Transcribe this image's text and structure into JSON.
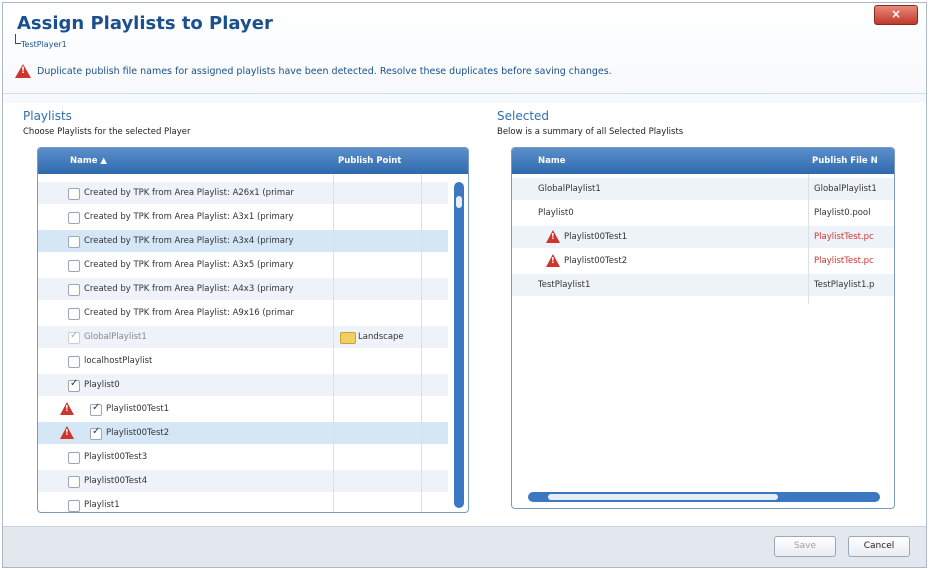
{
  "dialog": {
    "title": "Assign Playlists to Player",
    "subtitle": "TestPlayer1",
    "close_label": "×",
    "warning": "Duplicate publish file names for assigned playlists have been detected.  Resolve these duplicates before saving changes."
  },
  "left": {
    "title": "Playlists",
    "subtitle": "Choose Playlists for the selected Player",
    "col_name": "Name ▲",
    "col_publish": "Publish Point",
    "rows": [
      {
        "label": "Created by TPK from Area Playlist: A26x1 (primar",
        "publish": "",
        "checked": false,
        "warn": false,
        "style": "alt"
      },
      {
        "label": "Created by TPK from Area Playlist: A3x1 (primary",
        "publish": "",
        "checked": false,
        "warn": false,
        "style": ""
      },
      {
        "label": "Created by TPK from Area Playlist: A3x4 (primary",
        "publish": "",
        "checked": false,
        "warn": false,
        "style": "sel"
      },
      {
        "label": "Created by TPK from Area Playlist: A3x5 (primary",
        "publish": "",
        "checked": false,
        "warn": false,
        "style": ""
      },
      {
        "label": "Created by TPK from Area Playlist: A4x3 (primary",
        "publish": "",
        "checked": false,
        "warn": false,
        "style": "alt"
      },
      {
        "label": "Created by TPK from Area Playlist: A9x16 (primar",
        "publish": "",
        "checked": false,
        "warn": false,
        "style": ""
      },
      {
        "label": "GlobalPlaylist1",
        "publish": "Landscape",
        "checked": true,
        "dim": true,
        "warn": false,
        "style": "alt"
      },
      {
        "label": "localhostPlaylist",
        "publish": "",
        "checked": false,
        "warn": false,
        "style": ""
      },
      {
        "label": "Playlist0",
        "publish": "",
        "checked": true,
        "warn": false,
        "style": "alt"
      },
      {
        "label": "Playlist00Test1",
        "publish": "",
        "checked": true,
        "warn": true,
        "style": ""
      },
      {
        "label": "Playlist00Test2",
        "publish": "",
        "checked": true,
        "warn": true,
        "style": "sel"
      },
      {
        "label": "Playlist00Test3",
        "publish": "",
        "checked": false,
        "warn": false,
        "style": ""
      },
      {
        "label": "Playlist00Test4",
        "publish": "",
        "checked": false,
        "warn": false,
        "style": "alt"
      },
      {
        "label": "Playlist1",
        "publish": "",
        "checked": false,
        "warn": false,
        "style": ""
      }
    ]
  },
  "right": {
    "title": "Selected",
    "subtitle": "Below is a summary of all Selected Playlists",
    "col_name": "Name",
    "col_file": "Publish File N",
    "rows": [
      {
        "name": "GlobalPlaylist1",
        "file": "GlobalPlaylist1",
        "warn": false,
        "style": "alt"
      },
      {
        "name": "Playlist0",
        "file": "Playlist0.pool",
        "warn": false,
        "style": ""
      },
      {
        "name": "Playlist00Test1",
        "file": "PlaylistTest.pc",
        "warn": true,
        "style": "alt"
      },
      {
        "name": "Playlist00Test2",
        "file": "PlaylistTest.pc",
        "warn": true,
        "style": ""
      },
      {
        "name": "TestPlaylist1",
        "file": "TestPlaylist1.p",
        "warn": false,
        "style": "alt"
      }
    ]
  },
  "footer": {
    "save_label": "Save",
    "cancel_label": "Cancel"
  },
  "colors": {
    "accent": "#2f6aad",
    "error": "#d0342c"
  }
}
